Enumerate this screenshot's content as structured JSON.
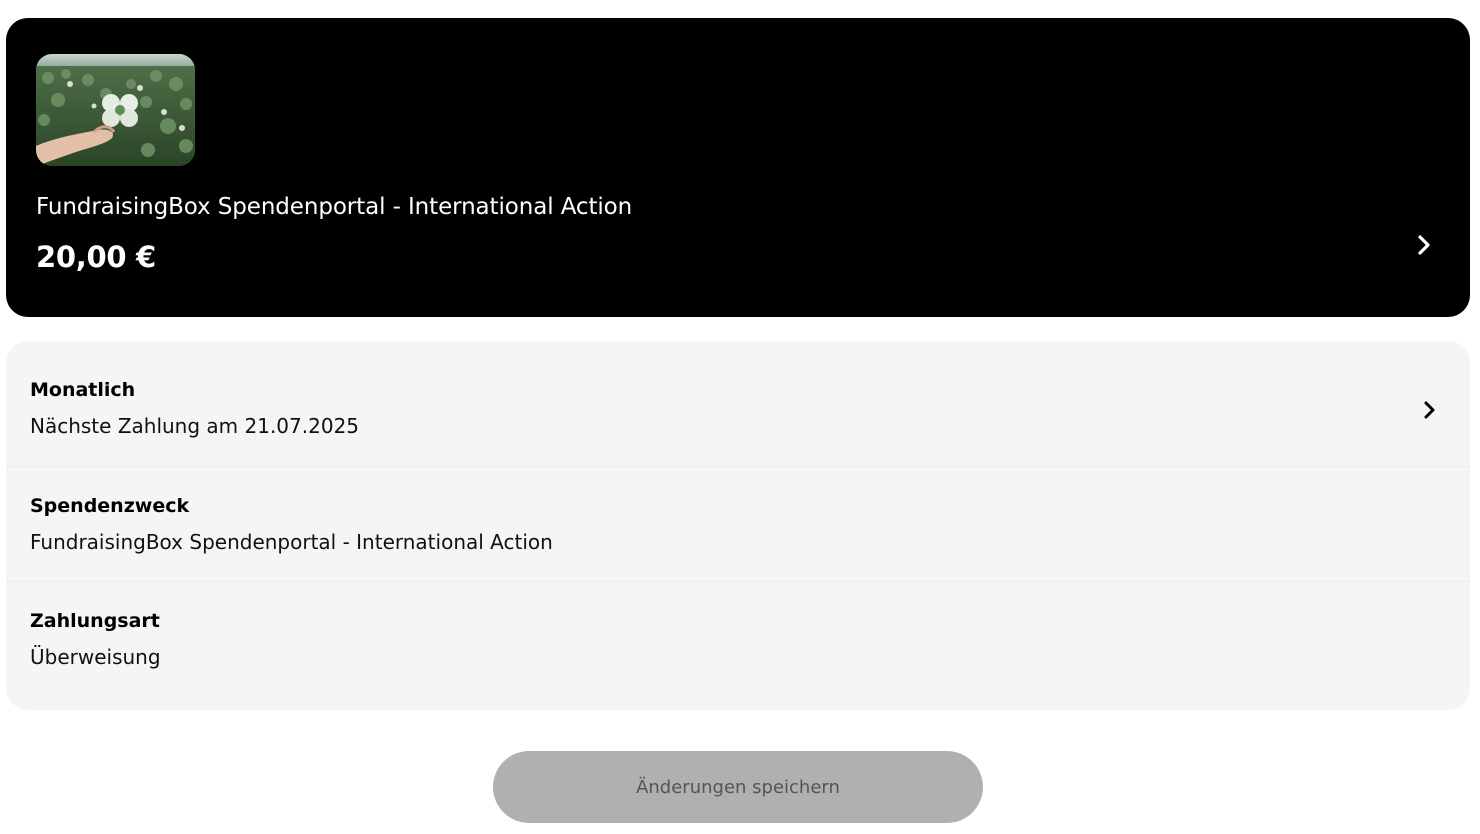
{
  "donation_card": {
    "image_alt": "Hand holding a four-leaf clover in a clover field",
    "title": "FundraisingBox Spendenportal - International Action",
    "amount": "20,00 €"
  },
  "details": {
    "frequency": {
      "label": "Monatlich",
      "value": "Nächste Zahlung am 21.07.2025"
    },
    "purpose": {
      "label": "Spendenzweck",
      "value": "FundraisingBox Spendenportal - International Action"
    },
    "payment_method": {
      "label": "Zahlungsart",
      "value": "Überweisung"
    }
  },
  "save_button": {
    "label": "Änderungen speichern",
    "state": "disabled"
  },
  "icons": {
    "card_chevron": "chevron-right-icon",
    "frequency_chevron": "chevron-right-icon"
  },
  "colors": {
    "card_background": "#000000",
    "details_background": "#f5f5f5",
    "button_disabled_background": "#b0b0b0",
    "button_disabled_text": "#555555"
  }
}
